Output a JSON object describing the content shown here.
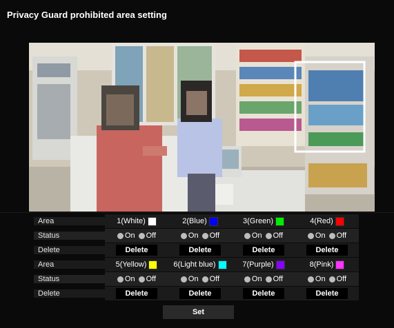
{
  "title": "Privacy Guard prohibited area setting",
  "labels": {
    "area": "Area",
    "status": "Status",
    "delete": "Delete"
  },
  "status_options": {
    "on": "On",
    "off": "Off"
  },
  "delete_label": "Delete",
  "set_label": "Set",
  "areas": [
    {
      "label": "1(White)",
      "color": "#ffffff"
    },
    {
      "label": "2(Blue)",
      "color": "#0000ff"
    },
    {
      "label": "3(Green)",
      "color": "#00ee00"
    },
    {
      "label": "4(Red)",
      "color": "#ff0000"
    },
    {
      "label": "5(Yellow)",
      "color": "#ffff00"
    },
    {
      "label": "6(Light blue)",
      "color": "#00ffff"
    },
    {
      "label": "7(Purple)",
      "color": "#8800ff"
    },
    {
      "label": "8(Pink)",
      "color": "#ff33ff"
    }
  ],
  "icons": {
    "radio": "radio-icon",
    "color_swatch": "color-swatch-icon"
  }
}
